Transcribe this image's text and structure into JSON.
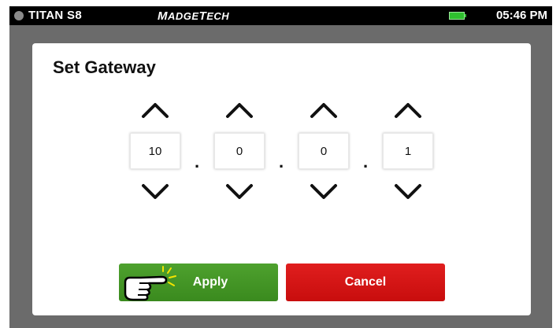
{
  "status_bar": {
    "device_name": "TITAN S8",
    "brand_lead": "M",
    "brand_small": "ADGE",
    "brand_lead2": "T",
    "brand_small2": "ECH",
    "time": "05:46 PM",
    "battery_icon": "battery-full-icon",
    "battery_color": "#2fbf2f"
  },
  "dialog": {
    "title": "Set Gateway",
    "octets": [
      {
        "value": "10"
      },
      {
        "value": "0"
      },
      {
        "value": "0"
      },
      {
        "value": "1"
      }
    ],
    "separator": ".",
    "apply_label": "Apply",
    "cancel_label": "Cancel",
    "apply_color": "#43941f",
    "cancel_color": "#d41515",
    "pointer_icon": "hand-pointer-icon"
  }
}
